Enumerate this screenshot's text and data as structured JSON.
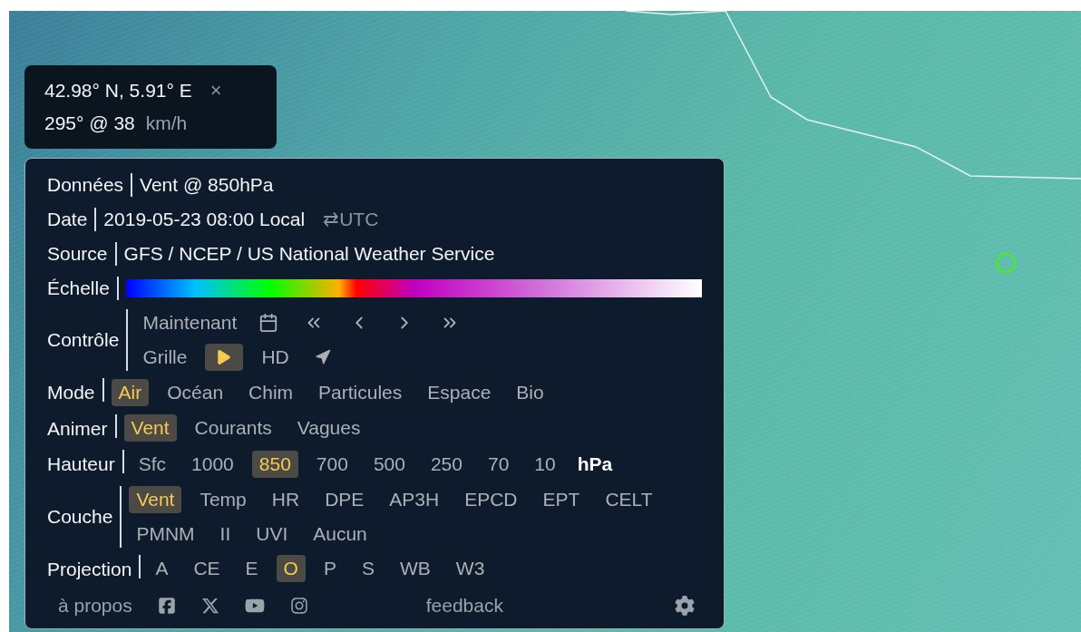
{
  "location": {
    "coords": "42.98° N, 5.91° E",
    "close": "×",
    "reading": "295° @ 38",
    "unit": "km/h"
  },
  "info": [
    {
      "label": "Données",
      "value": "Vent @ 850hPa"
    },
    {
      "label": "Date",
      "value": "2019-05-23 08:00 Local",
      "toggle": "⇄UTC"
    },
    {
      "label": "Source",
      "value": "GFS / NCEP / US National Weather Service"
    }
  ],
  "scale": {
    "label": "Échelle"
  },
  "control": {
    "label": "Contrôle",
    "now": "Maintenant",
    "grid": {
      "label": "Grille",
      "on": false
    },
    "play": {
      "on": true
    },
    "hd": {
      "label": "HD",
      "on": false
    },
    "locate": {
      "on": false
    }
  },
  "options": [
    {
      "label": "Mode",
      "items": [
        {
          "label": "Air",
          "selected": true
        },
        {
          "label": "Océan",
          "selected": false
        },
        {
          "label": "Chim",
          "selected": false
        },
        {
          "label": "Particules",
          "selected": false
        },
        {
          "label": "Espace",
          "selected": false
        },
        {
          "label": "Bio",
          "selected": false
        }
      ]
    },
    {
      "label": "Animer",
      "items": [
        {
          "label": "Vent",
          "selected": true
        },
        {
          "label": "Courants",
          "selected": false
        },
        {
          "label": "Vagues",
          "selected": false
        }
      ]
    },
    {
      "label": "Hauteur",
      "unit": "hPa",
      "items": [
        {
          "label": "Sfc",
          "selected": false
        },
        {
          "label": "1000",
          "selected": false
        },
        {
          "label": "850",
          "selected": true
        },
        {
          "label": "700",
          "selected": false
        },
        {
          "label": "500",
          "selected": false
        },
        {
          "label": "250",
          "selected": false
        },
        {
          "label": "70",
          "selected": false
        },
        {
          "label": "10",
          "selected": false
        }
      ]
    },
    {
      "label": "Couche",
      "items": [
        {
          "label": "Vent",
          "selected": true
        },
        {
          "label": "Temp",
          "selected": false
        },
        {
          "label": "HR",
          "selected": false
        },
        {
          "label": "DPE",
          "selected": false
        },
        {
          "label": "AP3H",
          "selected": false
        },
        {
          "label": "EPCD",
          "selected": false
        },
        {
          "label": "EPT",
          "selected": false
        },
        {
          "label": "CELT",
          "selected": false
        },
        {
          "label": "PMNM",
          "selected": false
        },
        {
          "label": "II",
          "selected": false
        },
        {
          "label": "UVI",
          "selected": false
        },
        {
          "label": "Aucun",
          "selected": false
        }
      ]
    },
    {
      "label": "Projection",
      "items": [
        {
          "label": "A",
          "selected": false
        },
        {
          "label": "CE",
          "selected": false
        },
        {
          "label": "E",
          "selected": false
        },
        {
          "label": "O",
          "selected": true
        },
        {
          "label": "P",
          "selected": false
        },
        {
          "label": "S",
          "selected": false
        },
        {
          "label": "WB",
          "selected": false
        },
        {
          "label": "W3",
          "selected": false
        }
      ]
    }
  ],
  "footer": {
    "about": "à propos",
    "feedback": "feedback"
  }
}
